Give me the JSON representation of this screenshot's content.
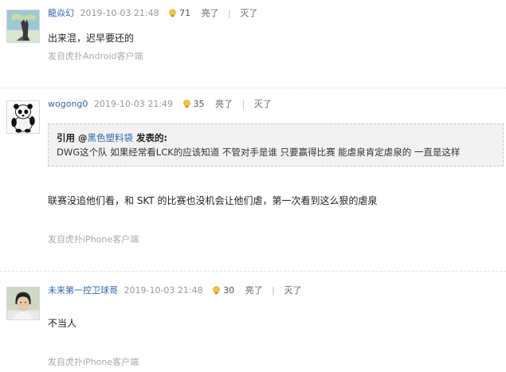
{
  "comments": [
    {
      "username": "龍焱幻",
      "time": "2019-10-03 21:48",
      "up_count": "71",
      "like_label": "亮了",
      "dislike_label": "灭了",
      "text": "出来混，迟早要还的",
      "source": "发自虎扑Android客户端",
      "avatar": "wolf-avatar"
    },
    {
      "username": "wogong0",
      "time": "2019-10-03 21:49",
      "up_count": "35",
      "like_label": "亮了",
      "dislike_label": "灭了",
      "quote": {
        "prefix": "引用 @",
        "author": "黑色塑料袋",
        "suffix": " 发表的:",
        "text": "DWG这个队 如果经常看LCK的应该知道 不管对手是谁 只要赢得比赛 能虐泉肯定虐泉的 一直是这样"
      },
      "text": "联赛没追他们看，和 SKT 的比赛也没机会让他们虐，第一次看到这么狠的虐泉",
      "source": "发自虎扑iPhone客户端",
      "avatar": "panda-avatar"
    },
    {
      "username": "未来第一控卫球哥",
      "time": "2019-10-03 21:48",
      "up_count": "30",
      "like_label": "亮了",
      "dislike_label": "灭了",
      "text": "不当人",
      "source": "发自虎扑iPhone客户端",
      "avatar": "person-avatar"
    }
  ],
  "colors": {
    "username": "#3366aa",
    "meta": "#999999",
    "quote_bg": "#f2f2f2"
  }
}
